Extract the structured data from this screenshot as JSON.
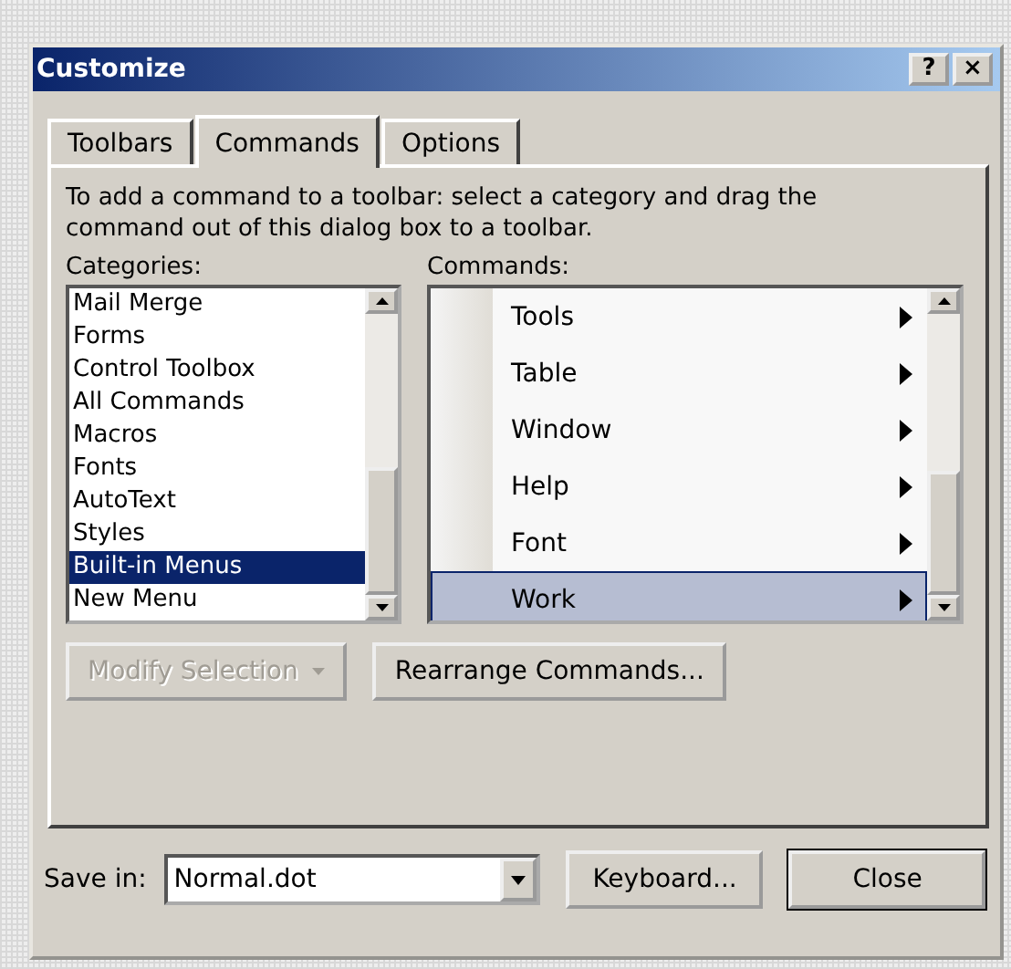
{
  "window": {
    "title": "Customize",
    "title_buttons": [
      "?",
      "×"
    ]
  },
  "tabs": [
    {
      "label": "Toolbars",
      "selected": false
    },
    {
      "label": "Commands",
      "selected": true
    },
    {
      "label": "Options",
      "selected": false
    }
  ],
  "instructions": "To add a command to a toolbar: select a category and drag the command out of this dialog box to a toolbar.",
  "categories": {
    "label": "Categories:",
    "items": [
      {
        "label": "Mail Merge",
        "selected": false
      },
      {
        "label": "Forms",
        "selected": false
      },
      {
        "label": "Control Toolbox",
        "selected": false
      },
      {
        "label": "All Commands",
        "selected": false
      },
      {
        "label": "Macros",
        "selected": false
      },
      {
        "label": "Fonts",
        "selected": false
      },
      {
        "label": "AutoText",
        "selected": false
      },
      {
        "label": "Styles",
        "selected": false
      },
      {
        "label": "Built-in Menus",
        "selected": true
      },
      {
        "label": "New Menu",
        "selected": false
      }
    ]
  },
  "commands": {
    "label": "Commands:",
    "items": [
      {
        "label": "Tools",
        "selected": false
      },
      {
        "label": "Table",
        "selected": false
      },
      {
        "label": "Window",
        "selected": false
      },
      {
        "label": "Help",
        "selected": false
      },
      {
        "label": "Font",
        "selected": false
      },
      {
        "label": "Work",
        "selected": true
      }
    ]
  },
  "actions": [
    {
      "label": "Modify Selection",
      "disabled": true,
      "dropdown": true
    },
    {
      "label": "Rearrange Commands...",
      "disabled": false,
      "dropdown": false
    }
  ],
  "save_in": {
    "label": "Save in:",
    "value": "Normal.dot"
  },
  "buttons": [
    {
      "label": "Keyboard...",
      "default": false
    },
    {
      "label": "Close",
      "default": true
    }
  ]
}
